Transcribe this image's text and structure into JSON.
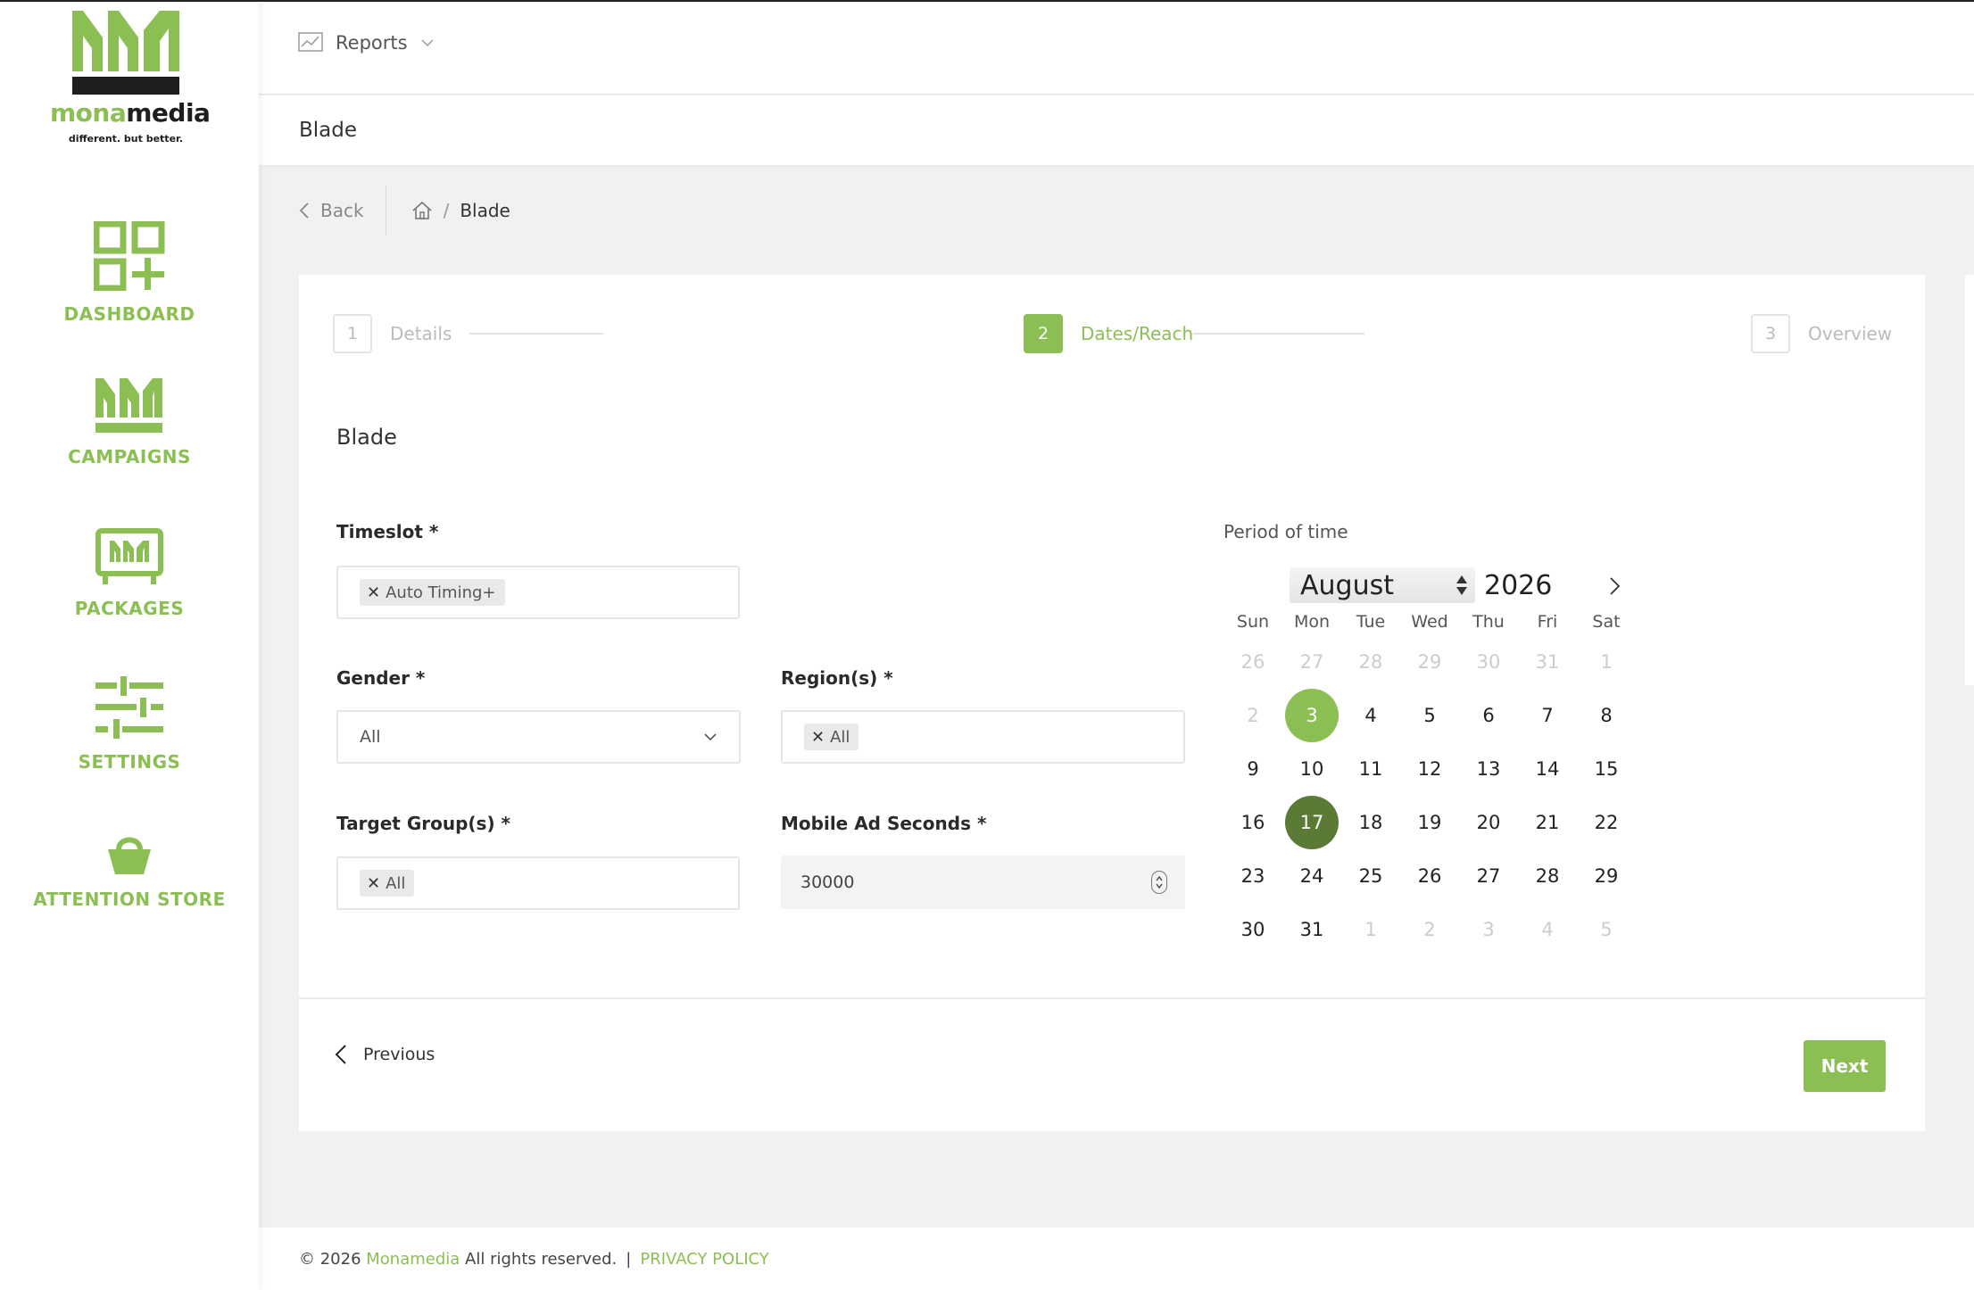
{
  "brand": {
    "name_green": "mona",
    "name_dark": "media",
    "tagline": "different. but better.",
    "accent": "#8cbf53",
    "accent_dark": "#5a7a36"
  },
  "sidebar": {
    "items": [
      {
        "label": "DASHBOARD",
        "icon": "dashboard-grid-icon"
      },
      {
        "label": "CAMPAIGNS",
        "icon": "campaigns-bars-icon"
      },
      {
        "label": "PACKAGES",
        "icon": "packages-screen-icon"
      },
      {
        "label": "SETTINGS",
        "icon": "settings-sliders-icon"
      },
      {
        "label": "ATTENTION STORE",
        "icon": "basket-icon"
      }
    ]
  },
  "header": {
    "reports_label": "Reports",
    "page_title": "Blade"
  },
  "breadcrumb": {
    "back_label": "Back",
    "separator": "/",
    "current": "Blade"
  },
  "stepper": {
    "steps": [
      {
        "number": "1",
        "label": "Details",
        "state": "inactive"
      },
      {
        "number": "2",
        "label": "Dates/Reach",
        "state": "active"
      },
      {
        "number": "3",
        "label": "Overview",
        "state": "inactive"
      }
    ]
  },
  "form": {
    "section_title": "Blade",
    "timeslot": {
      "label": "Timeslot *",
      "chips": [
        "Auto Timing+"
      ]
    },
    "gender": {
      "label": "Gender *",
      "value": "All"
    },
    "regions": {
      "label": "Region(s) *",
      "chips": [
        "All"
      ]
    },
    "target_groups": {
      "label": "Target Group(s) *",
      "chips": [
        "All"
      ]
    },
    "mobile_ad_seconds": {
      "label": "Mobile Ad Seconds *",
      "value": "30000"
    }
  },
  "calendar": {
    "label": "Period of time",
    "month": "August",
    "year": "2026",
    "weekdays": [
      "Sun",
      "Mon",
      "Tue",
      "Wed",
      "Thu",
      "Fri",
      "Sat"
    ],
    "weeks": [
      [
        {
          "d": "26",
          "m": true
        },
        {
          "d": "27",
          "m": true
        },
        {
          "d": "28",
          "m": true
        },
        {
          "d": "29",
          "m": true
        },
        {
          "d": "30",
          "m": true
        },
        {
          "d": "31",
          "m": true
        },
        {
          "d": "1",
          "m": true
        }
      ],
      [
        {
          "d": "2",
          "m": true
        },
        {
          "d": "3",
          "s": "start"
        },
        {
          "d": "4"
        },
        {
          "d": "5"
        },
        {
          "d": "6"
        },
        {
          "d": "7"
        },
        {
          "d": "8"
        }
      ],
      [
        {
          "d": "9"
        },
        {
          "d": "10"
        },
        {
          "d": "11"
        },
        {
          "d": "12"
        },
        {
          "d": "13"
        },
        {
          "d": "14"
        },
        {
          "d": "15"
        }
      ],
      [
        {
          "d": "16"
        },
        {
          "d": "17",
          "s": "end"
        },
        {
          "d": "18"
        },
        {
          "d": "19"
        },
        {
          "d": "20"
        },
        {
          "d": "21"
        },
        {
          "d": "22"
        }
      ],
      [
        {
          "d": "23"
        },
        {
          "d": "24"
        },
        {
          "d": "25"
        },
        {
          "d": "26"
        },
        {
          "d": "27"
        },
        {
          "d": "28"
        },
        {
          "d": "29"
        }
      ],
      [
        {
          "d": "30"
        },
        {
          "d": "31"
        },
        {
          "d": "1",
          "m": true
        },
        {
          "d": "2",
          "m": true
        },
        {
          "d": "3",
          "m": true
        },
        {
          "d": "4",
          "m": true
        },
        {
          "d": "5",
          "m": true
        }
      ]
    ]
  },
  "actions": {
    "previous_label": "Previous",
    "next_label": "Next"
  },
  "footer": {
    "copyright_prefix": "© 2026",
    "company": "Monamedia",
    "rights": "All rights reserved.",
    "separator": "|",
    "privacy_label": "PRIVACY POLICY"
  }
}
